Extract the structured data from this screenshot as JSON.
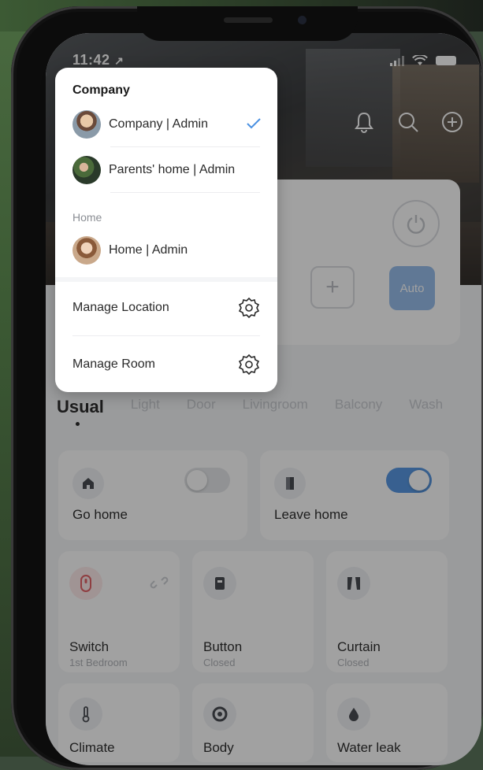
{
  "status_bar": {
    "time": "11:42",
    "location_arrow": "↗"
  },
  "header": {
    "icons": [
      "bell-icon",
      "search-icon",
      "add-icon"
    ]
  },
  "control_card": {
    "power_icon": "power-icon",
    "add_label": "+",
    "auto_label": "Auto"
  },
  "tabs": {
    "items": [
      "Usual",
      "Light",
      "Door",
      "Livingroom",
      "Balcony",
      "Wash"
    ],
    "active_index": 0
  },
  "scenes": [
    {
      "name": "Go home",
      "icon": "home-icon",
      "toggle_on": false
    },
    {
      "name": "Leave home",
      "icon": "door-icon",
      "toggle_on": true
    }
  ],
  "devices": [
    {
      "name": "Switch",
      "sub": "1st Bedroom",
      "icon": "switch-icon",
      "extra_icon": "unlink-icon"
    },
    {
      "name": "Button",
      "sub": "Closed",
      "icon": "button-icon"
    },
    {
      "name": "Curtain",
      "sub": "Closed",
      "icon": "curtain-icon"
    },
    {
      "name": "Climate",
      "icon": "thermometer-icon"
    },
    {
      "name": "Body",
      "icon": "target-icon"
    },
    {
      "name": "Water leak",
      "icon": "water-drop-icon"
    }
  ],
  "location_menu": {
    "company_title": "Company",
    "company_items": [
      {
        "label": "Company | Admin",
        "selected": true
      },
      {
        "label": "Parents' home | Admin",
        "selected": false
      }
    ],
    "home_title": "Home",
    "home_items": [
      {
        "label": "Home | Admin",
        "selected": false
      }
    ],
    "manage_location": "Manage Location",
    "manage_room": "Manage Room"
  },
  "colors": {
    "accent": "#4a90e2",
    "toggle_off": "#e3e5e8",
    "auto_bg": "#8fb8ea",
    "switch_red": "#e0555a"
  }
}
